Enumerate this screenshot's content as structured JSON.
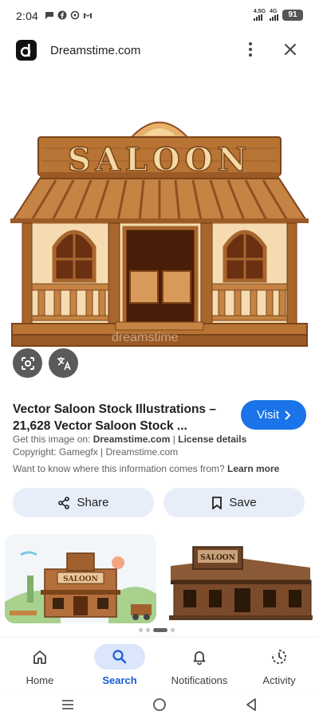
{
  "status": {
    "time": "2:04",
    "network_top": "4.5G",
    "network_bottom": "4G",
    "battery": "91",
    "icons": [
      "chat-bubble-icon",
      "facebook-icon",
      "settings-icon",
      "gmail-icon"
    ]
  },
  "header": {
    "site_name": "Dreamstime.com",
    "logo_letter": "d"
  },
  "hero": {
    "sign_text": "SALOON",
    "watermark": "dreamstime"
  },
  "result": {
    "title": "Vector Saloon Stock Illustrations – 21,628 Vector Saloon Stock ...",
    "visit_label": "Visit",
    "source_prefix": "Get this image on: ",
    "source_site": "Dreamstime.com",
    "source_sep": " | ",
    "license": "License details",
    "copyright": "Copyright: Gamegfx | Dreamstime.com",
    "info_prefix": "Want to know where this information comes from? ",
    "learn_more": "Learn more"
  },
  "actions": {
    "share_label": "Share",
    "save_label": "Save"
  },
  "related": {
    "image1_sign": "SALOON",
    "image2_sign": "SALOON"
  },
  "bottom_nav": {
    "items": [
      {
        "label": "Home",
        "icon": "home-icon"
      },
      {
        "label": "Search",
        "icon": "search-icon"
      },
      {
        "label": "Notifications",
        "icon": "bell-icon"
      },
      {
        "label": "Activity",
        "icon": "activity-icon"
      }
    ],
    "active": "Search"
  },
  "colors": {
    "accent": "#1a73e8",
    "chip_bg": "#e8eef9",
    "nav_active_bg": "#dbe6fb"
  }
}
